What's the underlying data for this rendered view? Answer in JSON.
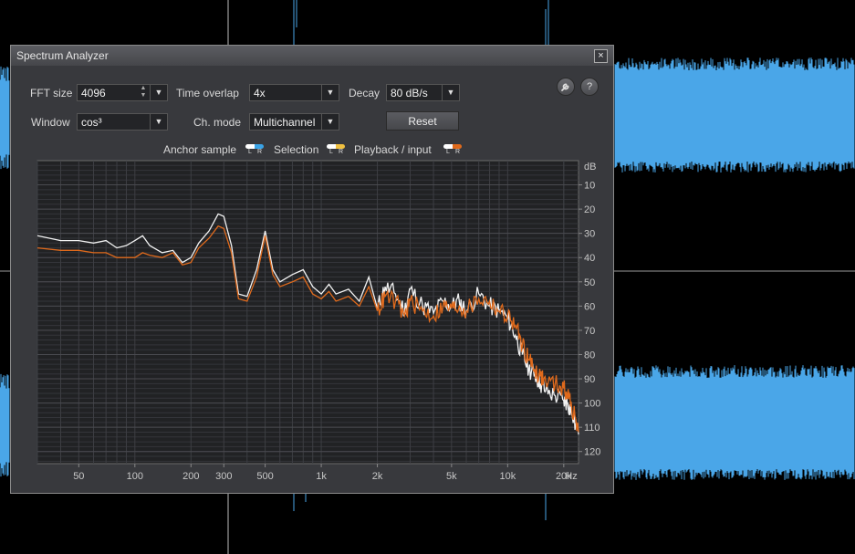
{
  "window": {
    "title": "Spectrum Analyzer",
    "close_label": "×"
  },
  "controls": {
    "fft_size": {
      "label": "FFT size",
      "value": "4096"
    },
    "time_overlap": {
      "label": "Time overlap",
      "value": "4x"
    },
    "decay": {
      "label": "Decay",
      "value": "80 dB/s"
    },
    "window_fn": {
      "label": "Window",
      "value": "cos³"
    },
    "ch_mode": {
      "label": "Ch. mode",
      "value": "Multichannel"
    },
    "reset_label": "Reset",
    "settings_icon": "wrench-icon",
    "help_label": "?"
  },
  "legend": {
    "anchor_sample": "Anchor sample",
    "selection": "Selection",
    "playback_input": "Playback / input",
    "l": "L",
    "r": "R",
    "colors": {
      "anchor_l": "#ffffff",
      "anchor_r": "#3aa3e6",
      "selection_l": "#ffffff",
      "selection_r": "#f0c040",
      "playback_l": "#ffffff",
      "playback_r": "#e06a1c"
    }
  },
  "chart_data": {
    "type": "line",
    "xscale": "log",
    "xlim": [
      30,
      24000
    ],
    "ylim": [
      -125,
      0
    ],
    "ylabel": "dB",
    "xlabel": "Hz",
    "x_ticks": [
      "50",
      "100",
      "200",
      "300",
      "500",
      "1k",
      "2k",
      "5k",
      "10k",
      "20k"
    ],
    "x_tick_values": [
      50,
      100,
      200,
      300,
      500,
      1000,
      2000,
      5000,
      10000,
      20000
    ],
    "y_ticks": [
      "10",
      "20",
      "30",
      "40",
      "50",
      "60",
      "70",
      "80",
      "90",
      "100",
      "110",
      "120"
    ],
    "y_tick_values": [
      -10,
      -20,
      -30,
      -40,
      -50,
      -60,
      -70,
      -80,
      -90,
      -100,
      -110,
      -120
    ],
    "grid": true,
    "series": [
      {
        "color": "#f2f2f2",
        "x": [
          30,
          40,
          50,
          60,
          70,
          80,
          90,
          100,
          110,
          120,
          140,
          160,
          180,
          200,
          220,
          250,
          280,
          300,
          330,
          360,
          400,
          450,
          500,
          550,
          600,
          700,
          800,
          900,
          1000,
          1100,
          1200,
          1400,
          1600,
          1800,
          2000,
          2200,
          2500,
          2800,
          3000,
          3500,
          4000,
          4500,
          5000,
          5500,
          6000,
          7000,
          8000,
          9000,
          10000,
          11000,
          12000,
          13000,
          14000,
          15000,
          16000,
          18000,
          20000,
          21000,
          22000,
          24000
        ],
        "y": [
          -31,
          -33,
          -33,
          -34,
          -33,
          -36,
          -35,
          -33,
          -31,
          -35,
          -38,
          -37,
          -42,
          -40,
          -34,
          -29,
          -22,
          -23,
          -35,
          -55,
          -56,
          -45,
          -29,
          -45,
          -50,
          -47,
          -45,
          -52,
          -55,
          -51,
          -55,
          -53,
          -58,
          -48,
          -61,
          -52,
          -55,
          -62,
          -53,
          -60,
          -63,
          -58,
          -60,
          -58,
          -62,
          -55,
          -60,
          -62,
          -65,
          -72,
          -80,
          -86,
          -88,
          -92,
          -95,
          -97,
          -99,
          -100,
          -104,
          -113
        ]
      },
      {
        "color": "#e06a1c",
        "x": [
          30,
          40,
          50,
          60,
          70,
          80,
          90,
          100,
          110,
          120,
          140,
          160,
          180,
          200,
          220,
          250,
          280,
          300,
          330,
          360,
          400,
          450,
          500,
          550,
          600,
          700,
          800,
          900,
          1000,
          1100,
          1200,
          1400,
          1600,
          1800,
          2000,
          2200,
          2500,
          2800,
          3000,
          3500,
          4000,
          4500,
          5000,
          5500,
          6000,
          7000,
          8000,
          9000,
          10000,
          11000,
          12000,
          13000,
          14000,
          15000,
          16000,
          18000,
          20000,
          21000,
          22000,
          24000
        ],
        "y": [
          -36,
          -37,
          -37,
          -38,
          -38,
          -40,
          -40,
          -40,
          -38,
          -39,
          -40,
          -38,
          -43,
          -42,
          -36,
          -32,
          -27,
          -28,
          -38,
          -57,
          -58,
          -48,
          -31,
          -47,
          -52,
          -50,
          -48,
          -55,
          -57,
          -54,
          -58,
          -56,
          -60,
          -52,
          -62,
          -56,
          -58,
          -64,
          -58,
          -62,
          -64,
          -60,
          -61,
          -60,
          -62,
          -57,
          -58,
          -62,
          -64,
          -68,
          -76,
          -82,
          -86,
          -89,
          -91,
          -92,
          -94,
          -96,
          -101,
          -112
        ]
      }
    ]
  }
}
